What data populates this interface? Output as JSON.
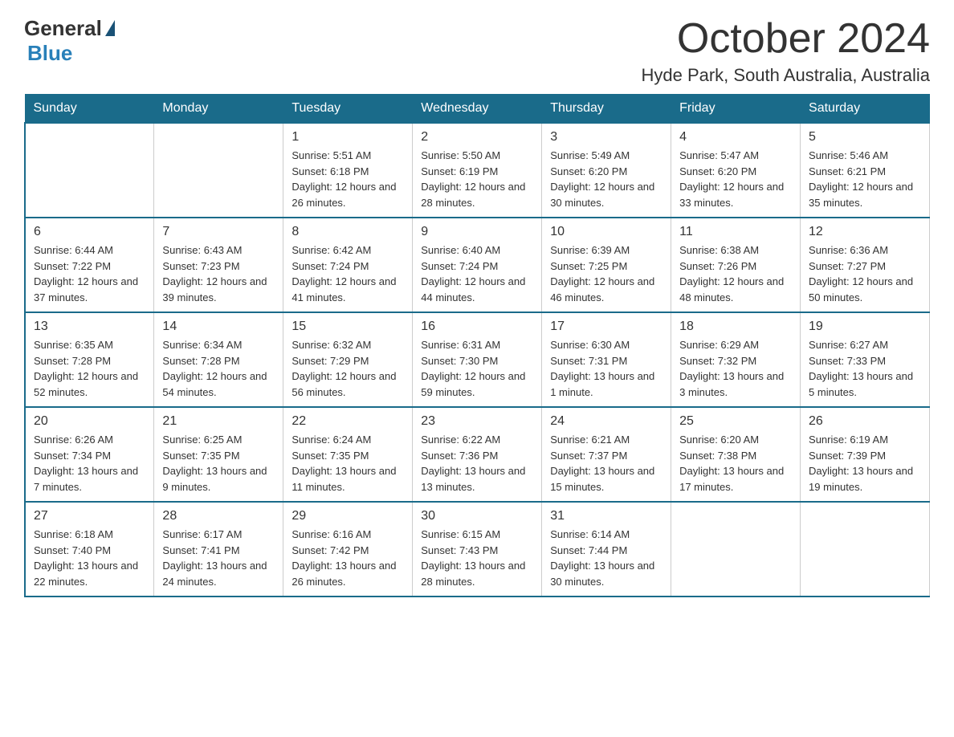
{
  "header": {
    "logo_general": "General",
    "logo_blue": "Blue",
    "month": "October 2024",
    "location": "Hyde Park, South Australia, Australia"
  },
  "days_of_week": [
    "Sunday",
    "Monday",
    "Tuesday",
    "Wednesday",
    "Thursday",
    "Friday",
    "Saturday"
  ],
  "weeks": [
    [
      {
        "day": "",
        "info": ""
      },
      {
        "day": "",
        "info": ""
      },
      {
        "day": "1",
        "info": "Sunrise: 5:51 AM\nSunset: 6:18 PM\nDaylight: 12 hours\nand 26 minutes."
      },
      {
        "day": "2",
        "info": "Sunrise: 5:50 AM\nSunset: 6:19 PM\nDaylight: 12 hours\nand 28 minutes."
      },
      {
        "day": "3",
        "info": "Sunrise: 5:49 AM\nSunset: 6:20 PM\nDaylight: 12 hours\nand 30 minutes."
      },
      {
        "day": "4",
        "info": "Sunrise: 5:47 AM\nSunset: 6:20 PM\nDaylight: 12 hours\nand 33 minutes."
      },
      {
        "day": "5",
        "info": "Sunrise: 5:46 AM\nSunset: 6:21 PM\nDaylight: 12 hours\nand 35 minutes."
      }
    ],
    [
      {
        "day": "6",
        "info": "Sunrise: 6:44 AM\nSunset: 7:22 PM\nDaylight: 12 hours\nand 37 minutes."
      },
      {
        "day": "7",
        "info": "Sunrise: 6:43 AM\nSunset: 7:23 PM\nDaylight: 12 hours\nand 39 minutes."
      },
      {
        "day": "8",
        "info": "Sunrise: 6:42 AM\nSunset: 7:24 PM\nDaylight: 12 hours\nand 41 minutes."
      },
      {
        "day": "9",
        "info": "Sunrise: 6:40 AM\nSunset: 7:24 PM\nDaylight: 12 hours\nand 44 minutes."
      },
      {
        "day": "10",
        "info": "Sunrise: 6:39 AM\nSunset: 7:25 PM\nDaylight: 12 hours\nand 46 minutes."
      },
      {
        "day": "11",
        "info": "Sunrise: 6:38 AM\nSunset: 7:26 PM\nDaylight: 12 hours\nand 48 minutes."
      },
      {
        "day": "12",
        "info": "Sunrise: 6:36 AM\nSunset: 7:27 PM\nDaylight: 12 hours\nand 50 minutes."
      }
    ],
    [
      {
        "day": "13",
        "info": "Sunrise: 6:35 AM\nSunset: 7:28 PM\nDaylight: 12 hours\nand 52 minutes."
      },
      {
        "day": "14",
        "info": "Sunrise: 6:34 AM\nSunset: 7:28 PM\nDaylight: 12 hours\nand 54 minutes."
      },
      {
        "day": "15",
        "info": "Sunrise: 6:32 AM\nSunset: 7:29 PM\nDaylight: 12 hours\nand 56 minutes."
      },
      {
        "day": "16",
        "info": "Sunrise: 6:31 AM\nSunset: 7:30 PM\nDaylight: 12 hours\nand 59 minutes."
      },
      {
        "day": "17",
        "info": "Sunrise: 6:30 AM\nSunset: 7:31 PM\nDaylight: 13 hours\nand 1 minute."
      },
      {
        "day": "18",
        "info": "Sunrise: 6:29 AM\nSunset: 7:32 PM\nDaylight: 13 hours\nand 3 minutes."
      },
      {
        "day": "19",
        "info": "Sunrise: 6:27 AM\nSunset: 7:33 PM\nDaylight: 13 hours\nand 5 minutes."
      }
    ],
    [
      {
        "day": "20",
        "info": "Sunrise: 6:26 AM\nSunset: 7:34 PM\nDaylight: 13 hours\nand 7 minutes."
      },
      {
        "day": "21",
        "info": "Sunrise: 6:25 AM\nSunset: 7:35 PM\nDaylight: 13 hours\nand 9 minutes."
      },
      {
        "day": "22",
        "info": "Sunrise: 6:24 AM\nSunset: 7:35 PM\nDaylight: 13 hours\nand 11 minutes."
      },
      {
        "day": "23",
        "info": "Sunrise: 6:22 AM\nSunset: 7:36 PM\nDaylight: 13 hours\nand 13 minutes."
      },
      {
        "day": "24",
        "info": "Sunrise: 6:21 AM\nSunset: 7:37 PM\nDaylight: 13 hours\nand 15 minutes."
      },
      {
        "day": "25",
        "info": "Sunrise: 6:20 AM\nSunset: 7:38 PM\nDaylight: 13 hours\nand 17 minutes."
      },
      {
        "day": "26",
        "info": "Sunrise: 6:19 AM\nSunset: 7:39 PM\nDaylight: 13 hours\nand 19 minutes."
      }
    ],
    [
      {
        "day": "27",
        "info": "Sunrise: 6:18 AM\nSunset: 7:40 PM\nDaylight: 13 hours\nand 22 minutes."
      },
      {
        "day": "28",
        "info": "Sunrise: 6:17 AM\nSunset: 7:41 PM\nDaylight: 13 hours\nand 24 minutes."
      },
      {
        "day": "29",
        "info": "Sunrise: 6:16 AM\nSunset: 7:42 PM\nDaylight: 13 hours\nand 26 minutes."
      },
      {
        "day": "30",
        "info": "Sunrise: 6:15 AM\nSunset: 7:43 PM\nDaylight: 13 hours\nand 28 minutes."
      },
      {
        "day": "31",
        "info": "Sunrise: 6:14 AM\nSunset: 7:44 PM\nDaylight: 13 hours\nand 30 minutes."
      },
      {
        "day": "",
        "info": ""
      },
      {
        "day": "",
        "info": ""
      }
    ]
  ]
}
